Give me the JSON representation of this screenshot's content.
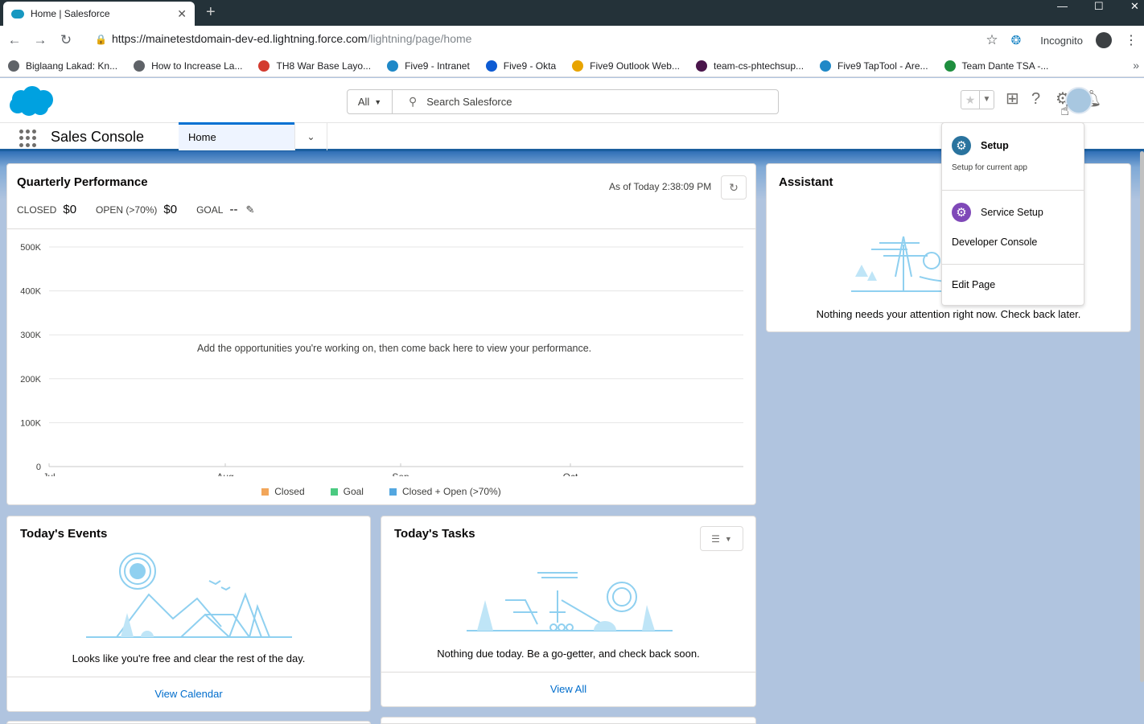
{
  "browser": {
    "tab_title": "Home | Salesforce",
    "url_host": "https://mainetestdomain-dev-ed.lightning.force.com",
    "url_path": "/lightning/page/home",
    "incognito_label": "Incognito",
    "bookmarks": [
      {
        "label": "Biglaang Lakad: Kn...",
        "color": "#5f6368"
      },
      {
        "label": "How to Increase La...",
        "color": "#5f6368"
      },
      {
        "label": "TH8 War Base Layo...",
        "color": "#d33b2f"
      },
      {
        "label": "Five9 - Intranet",
        "color": "#1f88c7"
      },
      {
        "label": "Five9 - Okta",
        "color": "#0d5bd3"
      },
      {
        "label": "Five9 Outlook Web...",
        "color": "#e8a400"
      },
      {
        "label": "team-cs-phtechsup...",
        "color": "#4a154b"
      },
      {
        "label": "Five9 TapTool - Are...",
        "color": "#1f88c7"
      },
      {
        "label": "Team Dante TSA -...",
        "color": "#1e8e3e"
      }
    ]
  },
  "header": {
    "search_scope": "All",
    "search_placeholder": "Search Salesforce"
  },
  "nav": {
    "app_name": "Sales Console",
    "tab_label": "Home"
  },
  "quarterly": {
    "title": "Quarterly Performance",
    "closed_label": "CLOSED",
    "closed_value": "$0",
    "open_label": "OPEN (>70%)",
    "open_value": "$0",
    "goal_label": "GOAL",
    "goal_value": "--",
    "as_of": "As of Today 2:38:09 PM",
    "empty_message": "Add the opportunities you're working on, then come back here to view your performance."
  },
  "chart_data": {
    "type": "line",
    "categories": [
      "Jul",
      "Aug",
      "Sep",
      "Oct"
    ],
    "y_ticks": [
      "500K",
      "400K",
      "300K",
      "200K",
      "100K",
      "0"
    ],
    "ylim": [
      0,
      500000
    ],
    "series": [
      {
        "name": "Closed",
        "color": "#f2a65a",
        "values": []
      },
      {
        "name": "Goal",
        "color": "#4bca81",
        "values": []
      },
      {
        "name": "Closed + Open (>70%)",
        "color": "#54a7e0",
        "values": []
      }
    ],
    "legend_position": "bottom"
  },
  "assistant": {
    "title": "Assistant",
    "message": "Nothing needs your attention right now. Check back later."
  },
  "events": {
    "title": "Today's Events",
    "message": "Looks like you're free and clear the rest of the day.",
    "footer_link": "View Calendar"
  },
  "tasks": {
    "title": "Today's Tasks",
    "message": "Nothing due today. Be a go-getter, and check back soon.",
    "footer_link": "View All"
  },
  "setup_menu": {
    "setup_label": "Setup",
    "setup_sub": "Setup for current app",
    "service_setup_label": "Service Setup",
    "dev_console_label": "Developer Console",
    "edit_page_label": "Edit Page",
    "setup_color": "#2a739e",
    "service_color": "#7f48b8"
  }
}
